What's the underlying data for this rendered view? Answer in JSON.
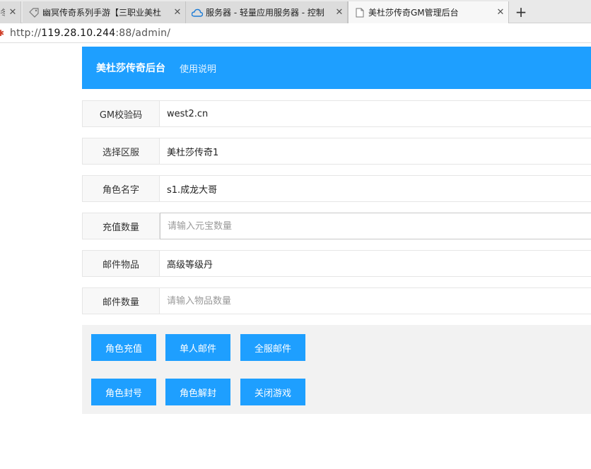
{
  "browser": {
    "tabs": [
      {
        "label": "幽冥传奇系列手游【三职业美杜",
        "icon": "tag-icon"
      },
      {
        "label": "服务器 - 轻量应用服务器 - 控制",
        "icon": "cloud-icon"
      },
      {
        "label": "美杜莎传奇GM管理后台",
        "icon": "page-icon",
        "active": true
      }
    ],
    "close_glyph": "✕",
    "new_tab_glyph": "+",
    "url_scheme": "http://",
    "url_host": "119.28.10.244",
    "url_rest": ":88/admin/"
  },
  "header": {
    "brand": "美杜莎传奇后台",
    "help_link": "使用说明",
    "color": "#1e9fff"
  },
  "form": {
    "gm_code": {
      "label": "GM校验码",
      "value": "west2.cn"
    },
    "server": {
      "label": "选择区服",
      "value": "美杜莎传奇1"
    },
    "role_name": {
      "label": "角色名字",
      "value": "s1.成龙大哥"
    },
    "recharge_amount": {
      "label": "充值数量",
      "value": "",
      "placeholder": "请输入元宝数量"
    },
    "mail_item": {
      "label": "邮件物品",
      "value": "高级等级丹"
    },
    "mail_quantity": {
      "label": "邮件数量",
      "value": "",
      "placeholder": "请输入物品数量"
    }
  },
  "actions": {
    "role_recharge": "角色充值",
    "single_mail": "单人邮件",
    "server_mail": "全服邮件",
    "ban_role": "角色封号",
    "unban_role": "角色解封",
    "close_game": "关闭游戏"
  }
}
